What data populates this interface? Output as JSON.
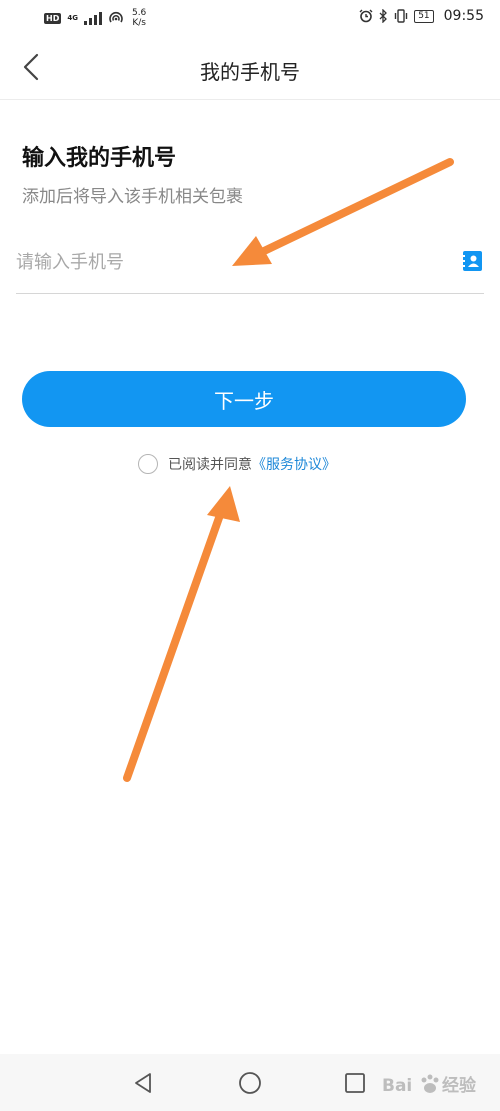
{
  "status_bar": {
    "network_hd": "HD",
    "network_type": "4G",
    "speed_value": "5.6",
    "speed_unit": "K/s",
    "battery": "51",
    "time": "09:55"
  },
  "header": {
    "title": "我的手机号"
  },
  "form": {
    "heading": "输入我的手机号",
    "subtext": "添加后将导入该手机相关包裹",
    "phone_placeholder": "请输入手机号",
    "phone_value": "",
    "next_label": "下一步"
  },
  "agreement": {
    "text": "已阅读并同意",
    "link": "《服务协议》",
    "checked": false
  },
  "watermark": {
    "logo": "Bai",
    "label": "经验"
  },
  "colors": {
    "accent": "#1296f2",
    "link": "#1e88d8",
    "annotation_arrow": "#f58a3a"
  },
  "icons": {
    "back": "chevron-left-icon",
    "contacts": "contact-book-icon",
    "nav_back": "triangle-back-icon",
    "nav_home": "circle-home-icon",
    "nav_recent": "square-recent-icon"
  }
}
